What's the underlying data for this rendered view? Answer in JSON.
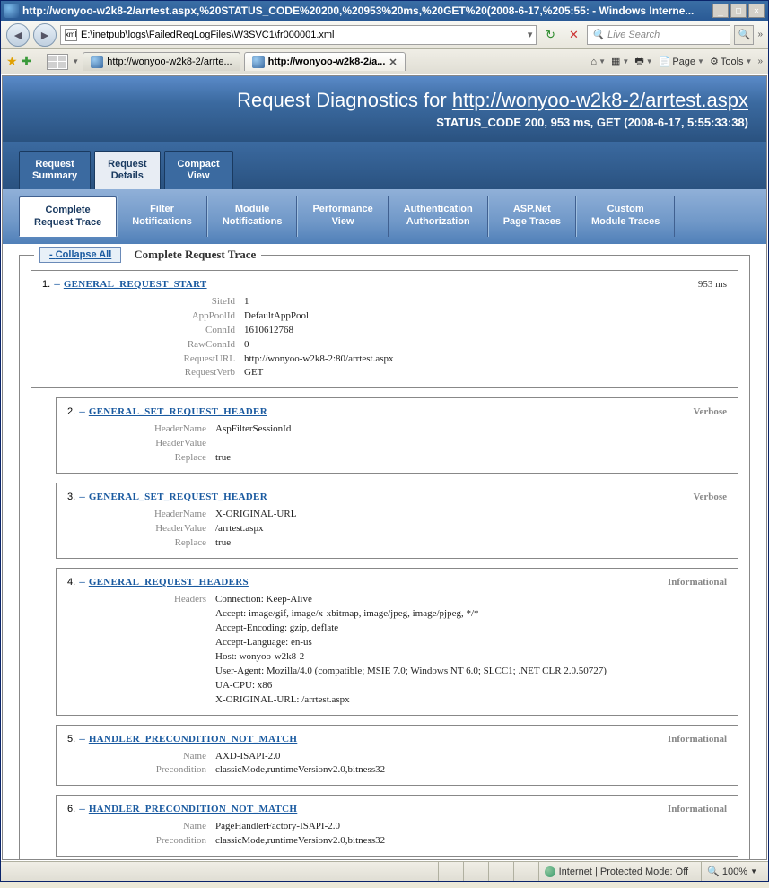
{
  "window": {
    "title": "http://wonyoo-w2k8-2/arrtest.aspx,%20STATUS_CODE%20200,%20953%20ms,%20GET%20(2008-6-17,%205:55: - Windows Interne..."
  },
  "address": {
    "url": "E:\\inetpub\\logs\\FailedReqLogFiles\\W3SVC1\\fr000001.xml"
  },
  "search": {
    "placeholder": "Live Search"
  },
  "tabs": {
    "inactive": "http://wonyoo-w2k8-2/arrte...",
    "active": "http://wonyoo-w2k8-2/a..."
  },
  "pageTools": {
    "page": "Page",
    "tools": "Tools"
  },
  "header": {
    "prefix": "Request Diagnostics for ",
    "url": "http://wonyoo-w2k8-2/arrtest.aspx",
    "sub": "STATUS_CODE 200, 953 ms, GET (2008-6-17, 5:55:33:38)"
  },
  "topTabs": {
    "summary": "Request\nSummary",
    "details": "Request\nDetails",
    "compact": "Compact\nView"
  },
  "subTabs": {
    "complete": "Complete\nRequest Trace",
    "filter": "Filter\nNotifications",
    "module": "Module\nNotifications",
    "perf": "Performance\nView",
    "auth": "Authentication\nAuthorization",
    "asp": "ASP.Net\nPage Traces",
    "custom": "Custom\nModule Traces"
  },
  "panel": {
    "collapse": "Collapse All",
    "title": "Complete Request Trace"
  },
  "events": [
    {
      "num": "1.",
      "name": "GENERAL_REQUEST_START",
      "time": "953 ms",
      "level": "",
      "inner": false,
      "rows": [
        {
          "k": "SiteId",
          "v": "1"
        },
        {
          "k": "AppPoolId",
          "v": "DefaultAppPool"
        },
        {
          "k": "ConnId",
          "v": "1610612768"
        },
        {
          "k": "RawConnId",
          "v": "0"
        },
        {
          "k": "RequestURL",
          "v": "http://wonyoo-w2k8-2:80/arrtest.aspx"
        },
        {
          "k": "RequestVerb",
          "v": "GET"
        }
      ]
    },
    {
      "num": "2.",
      "name": "GENERAL_SET_REQUEST_HEADER",
      "time": "",
      "level": "Verbose",
      "inner": true,
      "rows": [
        {
          "k": "HeaderName",
          "v": "AspFilterSessionId"
        },
        {
          "k": "HeaderValue",
          "v": ""
        },
        {
          "k": "Replace",
          "v": "true"
        }
      ]
    },
    {
      "num": "3.",
      "name": "GENERAL_SET_REQUEST_HEADER",
      "time": "",
      "level": "Verbose",
      "inner": true,
      "rows": [
        {
          "k": "HeaderName",
          "v": "X-ORIGINAL-URL"
        },
        {
          "k": "HeaderValue",
          "v": "/arrtest.aspx"
        },
        {
          "k": "Replace",
          "v": "true"
        }
      ]
    },
    {
      "num": "4.",
      "name": "GENERAL_REQUEST_HEADERS",
      "time": "",
      "level": "Informational",
      "inner": true,
      "rows": [
        {
          "k": "Headers",
          "v": "Connection: Keep-Alive\nAccept: image/gif, image/x-xbitmap, image/jpeg, image/pjpeg, */*\nAccept-Encoding: gzip, deflate\nAccept-Language: en-us\nHost: wonyoo-w2k8-2\nUser-Agent: Mozilla/4.0 (compatible; MSIE 7.0; Windows NT 6.0; SLCC1; .NET CLR 2.0.50727)\nUA-CPU: x86\nX-ORIGINAL-URL: /arrtest.aspx"
        }
      ]
    },
    {
      "num": "5.",
      "name": "HANDLER_PRECONDITION_NOT_MATCH",
      "time": "",
      "level": "Informational",
      "inner": true,
      "rows": [
        {
          "k": "Name",
          "v": "AXD-ISAPI-2.0"
        },
        {
          "k": "Precondition",
          "v": "classicMode,runtimeVersionv2.0,bitness32"
        }
      ]
    },
    {
      "num": "6.",
      "name": "HANDLER_PRECONDITION_NOT_MATCH",
      "time": "",
      "level": "Informational",
      "inner": true,
      "rows": [
        {
          "k": "Name",
          "v": "PageHandlerFactory-ISAPI-2.0"
        },
        {
          "k": "Precondition",
          "v": "classicMode,runtimeVersionv2.0,bitness32"
        }
      ]
    }
  ],
  "status": {
    "zone": "Internet | Protected Mode: Off",
    "zoom": "100%"
  }
}
